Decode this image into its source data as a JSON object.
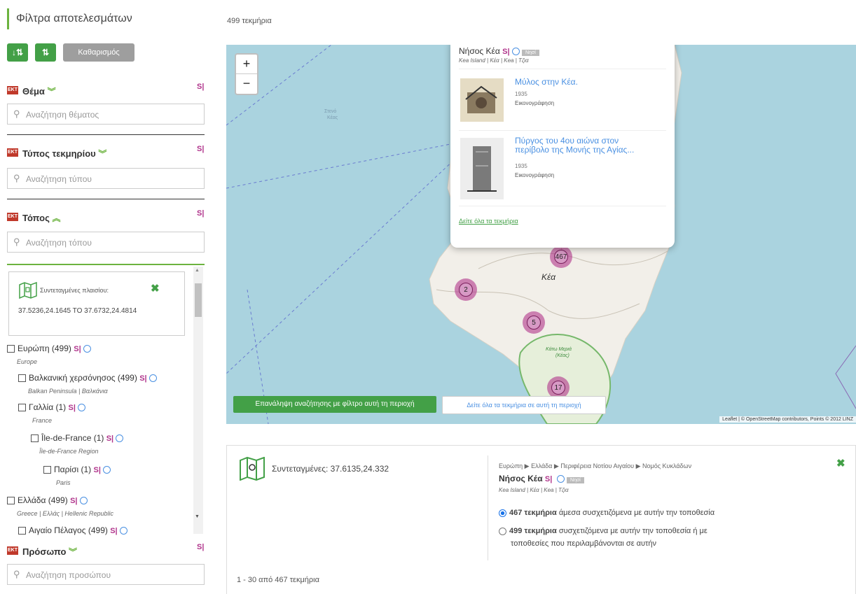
{
  "filters": {
    "title": "Φίλτρα αποτελεσμάτων",
    "sort_asc": "↓⇅",
    "sort_desc": "⇅",
    "clear_label": "Καθαρισμός",
    "ekt_badge": "EKT",
    "si_badge": "S|",
    "subject": {
      "title": "Θέμα",
      "search_placeholder": "Αναζήτηση θέματος"
    },
    "type": {
      "title": "Τύπος τεκμηρίου",
      "search_placeholder": "Αναζήτηση τύπου"
    },
    "place": {
      "title": "Τόπος",
      "search_placeholder": "Αναζήτηση τόπου"
    },
    "person": {
      "title": "Πρόσωπο",
      "search_placeholder": "Αναζήτηση προσώπου"
    },
    "bbox": {
      "label": "Συντεταγμένες πλαισίου:",
      "value": "37.5236,24.1645 TO 37.6732,24.4814"
    },
    "tree": [
      {
        "label": "Ευρώπη (499)",
        "sub": "Europe"
      },
      {
        "label": "Βαλκανική χερσόνησος (499)",
        "sub": "Balkan Peninsula | Βαλκάνια"
      },
      {
        "label": "Γαλλία (1)",
        "sub": "France"
      },
      {
        "label": "Île-de-France (1)",
        "sub": "Île-de-France Region"
      },
      {
        "label": "Παρίσι (1)",
        "sub": "Paris"
      },
      {
        "label": "Ελλάδα (499)",
        "sub": "Greece | Ελλάς | Hellenic Republic"
      },
      {
        "label": "Αιγαίο Πέλαγος (499)",
        "sub": ""
      }
    ]
  },
  "results": {
    "count_text": "499 τεκμήρια",
    "pagination": "1 - 30 από 467 τεκμήρια"
  },
  "map": {
    "zoom_in": "+",
    "zoom_out": "−",
    "island_label": "Κέα",
    "area_label_1": "Κάτω Μεριά",
    "area_label_2": "(Κέας)",
    "faint_label_1": "Στενό",
    "faint_label_2": "Κέας",
    "clusters": [
      "467",
      "2",
      "5",
      "17"
    ],
    "repeat_search": "Επανάληψη αναζήτησης με φίλτρο αυτή τη περιοχή",
    "see_all_area": "Δείτε όλα τα τεκμήρια σε αυτή τη περιοχή",
    "attribution": "Leaflet | © OpenStreetMap contributors, Points © 2012 LINZ",
    "popup": {
      "title": "Νήσος Κέα",
      "badge": "Νησί",
      "aliases": "Kea Island | Κέα | Kea | Τζια",
      "items": [
        {
          "title": "Μύλος στην Κέα.",
          "year": "1935",
          "type": "Εικονογράφηση"
        },
        {
          "title": "Πύργος του 4ου αιώνα στον περίβολο της Μονής της Αγίας...",
          "year": "1935",
          "type": "Εικονογράφηση"
        }
      ],
      "see_all": "Δείτε όλα τα τεκμήρια"
    }
  },
  "info": {
    "coords": "Συντεταγμένες: 37.6135,24.332",
    "breadcrumb": "Ευρώπη ▶ Ελλάδα ▶ Περιφέρεια Νοτίου Αιγαίου ▶ Νομός Κυκλάδων",
    "place_title": "Νήσος Κέα",
    "badge": "Νησί",
    "aliases": "Kea Island | Κέα | Kea | Τζια",
    "option1_count": "467 τεκμήρια",
    "option1_text": "άμεσα συσχετιζόμενα με αυτήν την τοποθεσία",
    "option2_count": "499 τεκμήρια",
    "option2_text_1": "συσχετιζόμενα με αυτήν την τοποθεσία ή με",
    "option2_text_2": "τοποθεσίες που περιλαμβάνονται σε αυτήν"
  },
  "colors": {
    "accent": "#6cb33f",
    "button_green": "#43a047",
    "si": "#b0338b",
    "cluster": "#b0338b",
    "sea": "#aad3df",
    "land": "#f2efe9"
  }
}
